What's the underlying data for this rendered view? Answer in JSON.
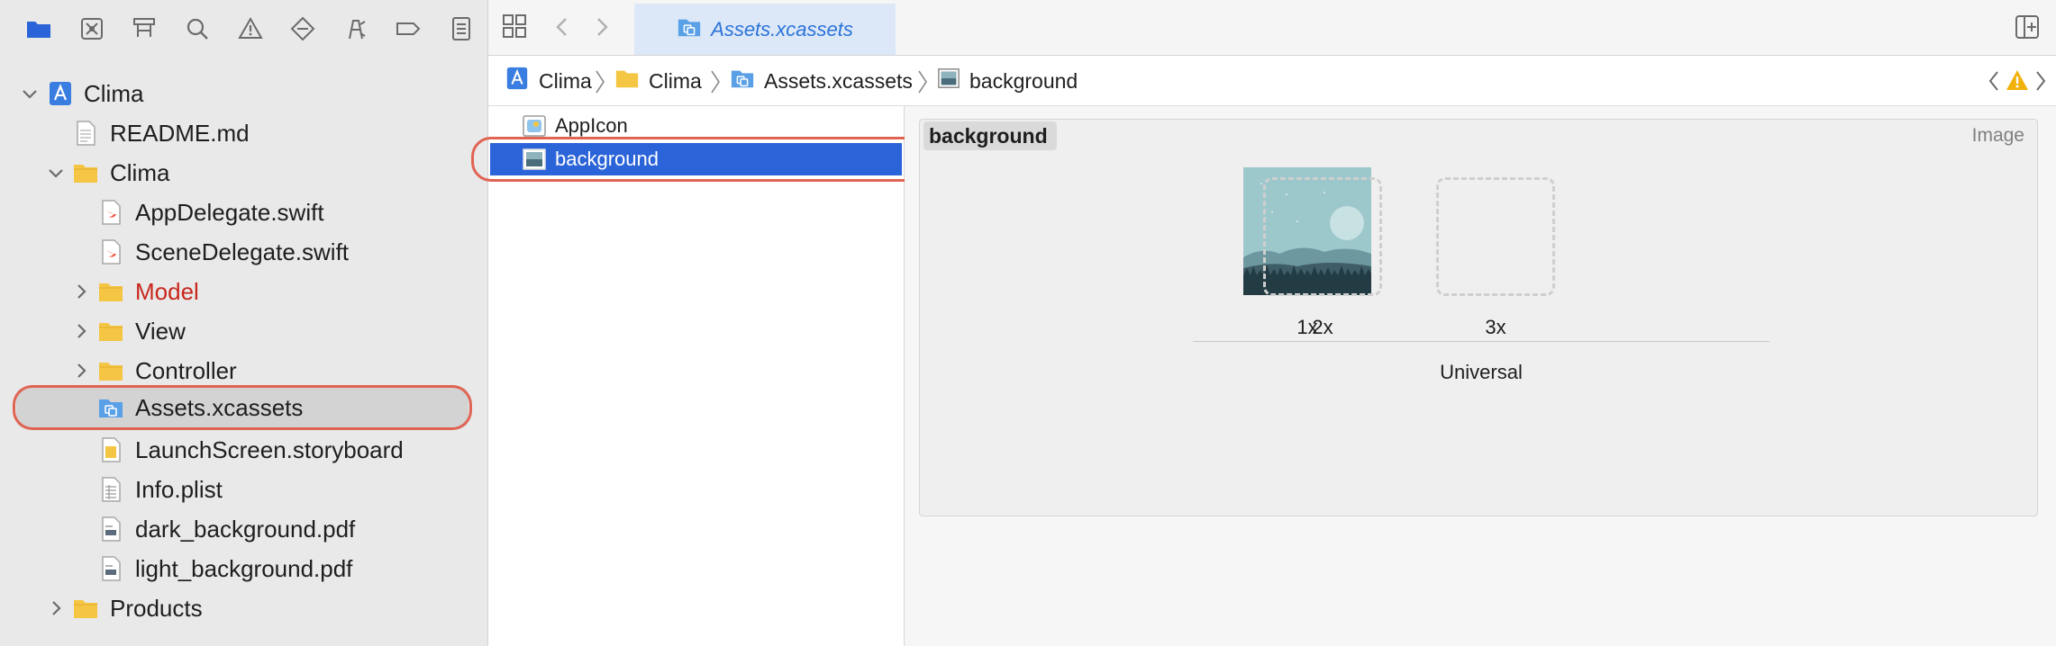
{
  "colors": {
    "accent": "#2b64d8",
    "folder": "#f5c544",
    "red_group": "#c8261c",
    "callout": "#e06454",
    "warning": "#f2b10a"
  },
  "navigator": {
    "toolbar_icons": [
      "folder-icon",
      "source-control-icon",
      "hierarchy-icon",
      "search-icon",
      "warning-icon",
      "test-icon",
      "debug-icon",
      "breakpoint-icon",
      "report-icon"
    ],
    "tree": [
      {
        "label": "Clima",
        "icon": "project-icon",
        "disclosure": "open"
      },
      {
        "label": "README.md",
        "icon": "text-file-icon",
        "disclosure": "none"
      },
      {
        "label": "Clima",
        "icon": "folder-icon",
        "disclosure": "open"
      },
      {
        "label": "AppDelegate.swift",
        "icon": "swift-file-icon",
        "disclosure": "none"
      },
      {
        "label": "SceneDelegate.swift",
        "icon": "swift-file-icon",
        "disclosure": "none"
      },
      {
        "label": "Model",
        "icon": "folder-icon",
        "disclosure": "closed"
      },
      {
        "label": "View",
        "icon": "folder-icon",
        "disclosure": "closed"
      },
      {
        "label": "Controller",
        "icon": "folder-icon",
        "disclosure": "closed"
      },
      {
        "label": "Assets.xcassets",
        "icon": "asset-catalog-icon",
        "disclosure": "none"
      },
      {
        "label": "LaunchScreen.storyboard",
        "icon": "storyboard-icon",
        "disclosure": "none"
      },
      {
        "label": "Info.plist",
        "icon": "plist-icon",
        "disclosure": "none"
      },
      {
        "label": "dark_background.pdf",
        "icon": "pdf-file-icon",
        "disclosure": "none"
      },
      {
        "label": "light_background.pdf",
        "icon": "pdf-file-icon",
        "disclosure": "none"
      },
      {
        "label": "Products",
        "icon": "folder-icon",
        "disclosure": "closed"
      }
    ]
  },
  "editor": {
    "tab_title": "Assets.xcassets",
    "breadcrumbs": [
      "Clima",
      "Clima",
      "Assets.xcassets",
      "background"
    ],
    "asset_list": [
      "AppIcon",
      "background"
    ],
    "detail": {
      "set_name": "background",
      "type_label": "Image",
      "slots": [
        "1x",
        "2x",
        "3x"
      ],
      "device": "Universal"
    }
  }
}
